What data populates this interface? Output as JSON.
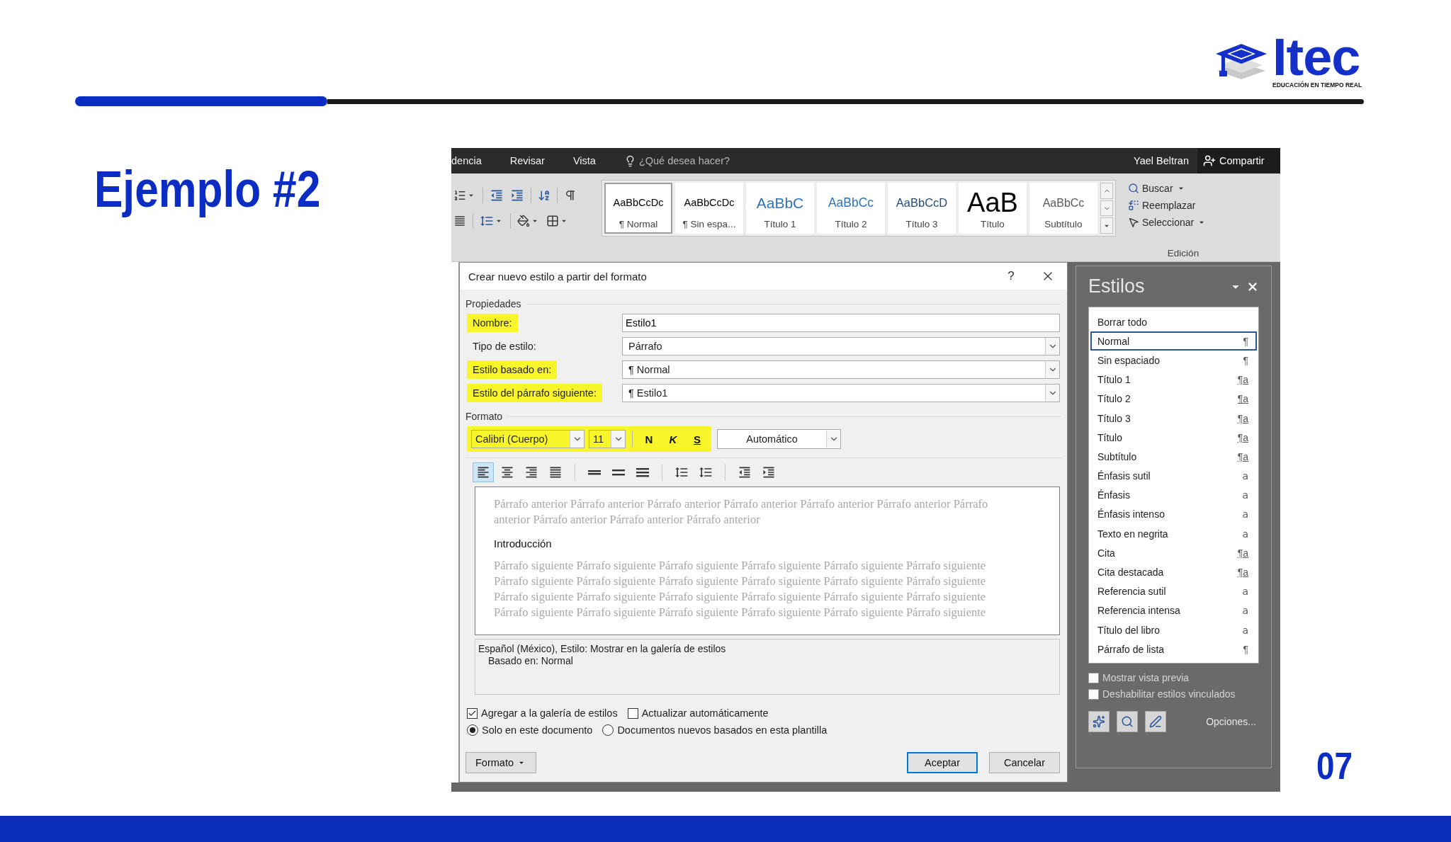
{
  "slide": {
    "title": "Ejemplo #2",
    "page_number": "07",
    "logo": {
      "name": "Itec",
      "tagline": "EDUCACIÓN EN TIEMPO REAL"
    }
  },
  "word": {
    "tabs": [
      "dencia",
      "Revisar",
      "Vista"
    ],
    "tell_me": {
      "placeholder": "¿Qué desea hacer?"
    },
    "user": "Yael Beltran",
    "share": "Compartir",
    "style_gallery": [
      {
        "sample": "AaBbCcDc",
        "name": "¶ Normal",
        "kind": "body",
        "selected": true
      },
      {
        "sample": "AaBbCcDc",
        "name": "¶ Sin espa...",
        "kind": "body",
        "selected": false
      },
      {
        "sample": "AaBbC",
        "name": "Título 1",
        "kind": "heading1",
        "selected": false
      },
      {
        "sample": "AaBbCc",
        "name": "Título 2",
        "kind": "heading2",
        "selected": false
      },
      {
        "sample": "AaBbCcD",
        "name": "Título 3",
        "kind": "heading3",
        "selected": false
      },
      {
        "sample": "AaB",
        "name": "Título",
        "kind": "title",
        "selected": false
      },
      {
        "sample": "AaBbCc",
        "name": "Subtítulo",
        "kind": "subtitle",
        "selected": false
      }
    ],
    "editing": {
      "label": "Edición",
      "commands": [
        {
          "label": "Buscar",
          "dropdown": true
        },
        {
          "label": "Reemplazar",
          "dropdown": false
        },
        {
          "label": "Seleccionar",
          "dropdown": true
        }
      ]
    },
    "dialog": {
      "title": "Crear nuevo estilo a partir del formato",
      "help": "?",
      "properties_heading": "Propiedades",
      "properties": [
        {
          "label": "Nombre:",
          "value": "Estilo1",
          "kind": "text",
          "highlighted": true
        },
        {
          "label": "Tipo de estilo:",
          "value": "Párrafo",
          "kind": "dropdown",
          "highlighted": false
        },
        {
          "label": "Estilo basado en:",
          "value": "¶ Normal",
          "kind": "dropdown",
          "highlighted": true
        },
        {
          "label": "Estilo del párrafo siguiente:",
          "value": "¶ Estilo1",
          "kind": "dropdown",
          "highlighted": true
        }
      ],
      "format_heading": "Formato",
      "font": {
        "family": "Calibri (Cuerpo)",
        "size": "11",
        "highlighted": true
      },
      "font_styles": [
        {
          "label": "N",
          "kind": "bold"
        },
        {
          "label": "K",
          "kind": "italic"
        },
        {
          "label": "S",
          "kind": "underline"
        }
      ],
      "font_color": "Automático",
      "tools": [
        {
          "kind": "align-left",
          "selected": true
        },
        {
          "kind": "align-center",
          "selected": false
        },
        {
          "kind": "align-right",
          "selected": false
        },
        {
          "kind": "justify",
          "selected": false
        },
        {
          "kind": "single",
          "selected": false
        },
        {
          "kind": "one-half",
          "selected": false
        },
        {
          "kind": "double",
          "selected": false
        },
        {
          "kind": "space-more",
          "selected": false
        },
        {
          "kind": "space-less",
          "selected": false
        },
        {
          "kind": "outdent",
          "selected": false
        },
        {
          "kind": "indent",
          "selected": false
        }
      ],
      "preview": {
        "previous": "Párrafo anterior Párrafo anterior Párrafo anterior Párrafo anterior Párrafo anterior Párrafo anterior Párrafo anterior Párrafo anterior Párrafo anterior Párrafo anterior",
        "sample": "Introducción",
        "following": "Párrafo siguiente Párrafo siguiente Párrafo siguiente Párrafo siguiente Párrafo siguiente Párrafo siguiente Párrafo siguiente Párrafo siguiente Párrafo siguiente Párrafo siguiente Párrafo siguiente Párrafo siguiente Párrafo siguiente Párrafo siguiente Párrafo siguiente Párrafo siguiente Párrafo siguiente Párrafo siguiente Párrafo siguiente Párrafo siguiente Párrafo siguiente Párrafo siguiente Párrafo siguiente Párrafo siguiente"
      },
      "description": [
        "Español (México), Estilo: Mostrar en la galería de estilos",
        "Basado en: Normal"
      ],
      "options": [
        {
          "label": "Agregar a la galería de estilos",
          "checked": true
        },
        {
          "label": "Actualizar automáticamente",
          "checked": false
        }
      ],
      "scope": [
        {
          "label": "Solo en este documento",
          "selected": true
        },
        {
          "label": "Documentos nuevos basados en esta plantilla",
          "selected": false
        }
      ],
      "format_button": "Formato",
      "buttons": [
        {
          "label": "Aceptar",
          "default": true
        },
        {
          "label": "Cancelar",
          "default": false
        }
      ]
    },
    "styles_pane": {
      "title": "Estilos",
      "items": [
        {
          "name": "Borrar todo",
          "selected": false
        },
        {
          "name": "Normal",
          "marker": "¶",
          "kind": "paragraph",
          "selected": true
        },
        {
          "name": "Sin espaciado",
          "marker": "¶",
          "kind": "paragraph",
          "selected": false
        },
        {
          "name": "Título 1",
          "marker": "¶a",
          "kind": "linked",
          "selected": false
        },
        {
          "name": "Título 2",
          "marker": "¶a",
          "kind": "linked",
          "selected": false
        },
        {
          "name": "Título 3",
          "marker": "¶a",
          "kind": "linked",
          "selected": false
        },
        {
          "name": "Título",
          "marker": "¶a",
          "kind": "linked",
          "selected": false
        },
        {
          "name": "Subtítulo",
          "marker": "¶a",
          "kind": "linked",
          "selected": false
        },
        {
          "name": "Énfasis sutil",
          "marker": "a",
          "kind": "character",
          "selected": false
        },
        {
          "name": "Énfasis",
          "marker": "a",
          "kind": "character",
          "selected": false
        },
        {
          "name": "Énfasis intenso",
          "marker": "a",
          "kind": "character",
          "selected": false
        },
        {
          "name": "Texto en negrita",
          "marker": "a",
          "kind": "character",
          "selected": false
        },
        {
          "name": "Cita",
          "marker": "¶a",
          "kind": "linked",
          "selected": false
        },
        {
          "name": "Cita destacada",
          "marker": "¶a",
          "kind": "linked",
          "selected": false
        },
        {
          "name": "Referencia sutil",
          "marker": "a",
          "kind": "character",
          "selected": false
        },
        {
          "name": "Referencia intensa",
          "marker": "a",
          "kind": "character",
          "selected": false
        },
        {
          "name": "Título del libro",
          "marker": "a",
          "kind": "character",
          "selected": false
        },
        {
          "name": "Párrafo de lista",
          "marker": "¶",
          "kind": "paragraph",
          "selected": false
        }
      ],
      "checkboxes": [
        {
          "label": "Mostrar vista previa",
          "checked": false
        },
        {
          "label": "Deshabilitar estilos vinculados",
          "checked": false
        }
      ],
      "options_link": "Opciones..."
    }
  }
}
